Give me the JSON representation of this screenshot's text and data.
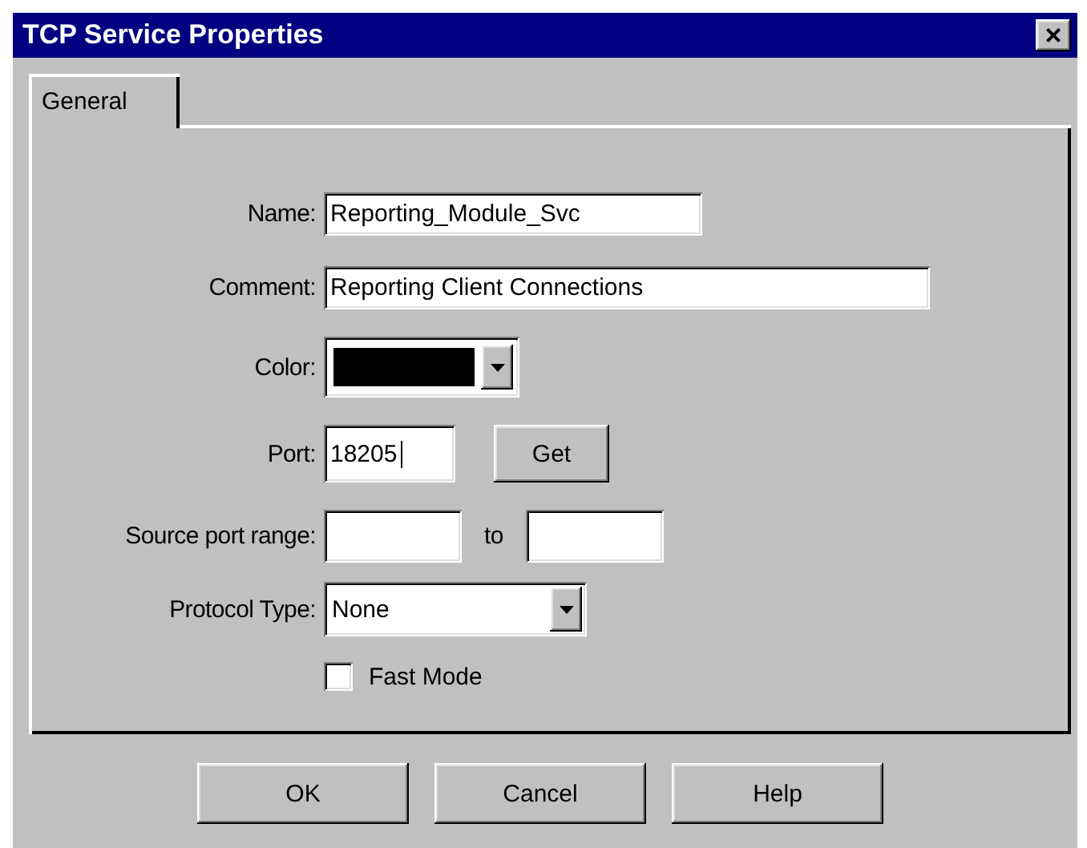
{
  "window": {
    "title": "TCP Service Properties",
    "close_label": "×"
  },
  "tabs": [
    {
      "label": "General",
      "selected": true
    }
  ],
  "form": {
    "rows": [
      {
        "kind": "text",
        "label": "Name:",
        "value": "Reporting_Module_Svc"
      },
      {
        "kind": "wide_text",
        "label": "Comment:",
        "value": "Reporting Client Connections"
      },
      {
        "kind": "color",
        "label": "Color:",
        "color": "#000000"
      },
      {
        "kind": "port",
        "label": "Port:",
        "value": "18205",
        "focused": true,
        "button": "Get"
      },
      {
        "kind": "range",
        "label": "Source port range:",
        "from": "",
        "separator": "to",
        "to": ""
      },
      {
        "kind": "select",
        "label": "Protocol Type:",
        "value": "None"
      },
      {
        "kind": "checkbox",
        "label": "Fast Mode",
        "checked": false
      }
    ]
  },
  "buttons": [
    "OK",
    "Cancel",
    "Help"
  ]
}
